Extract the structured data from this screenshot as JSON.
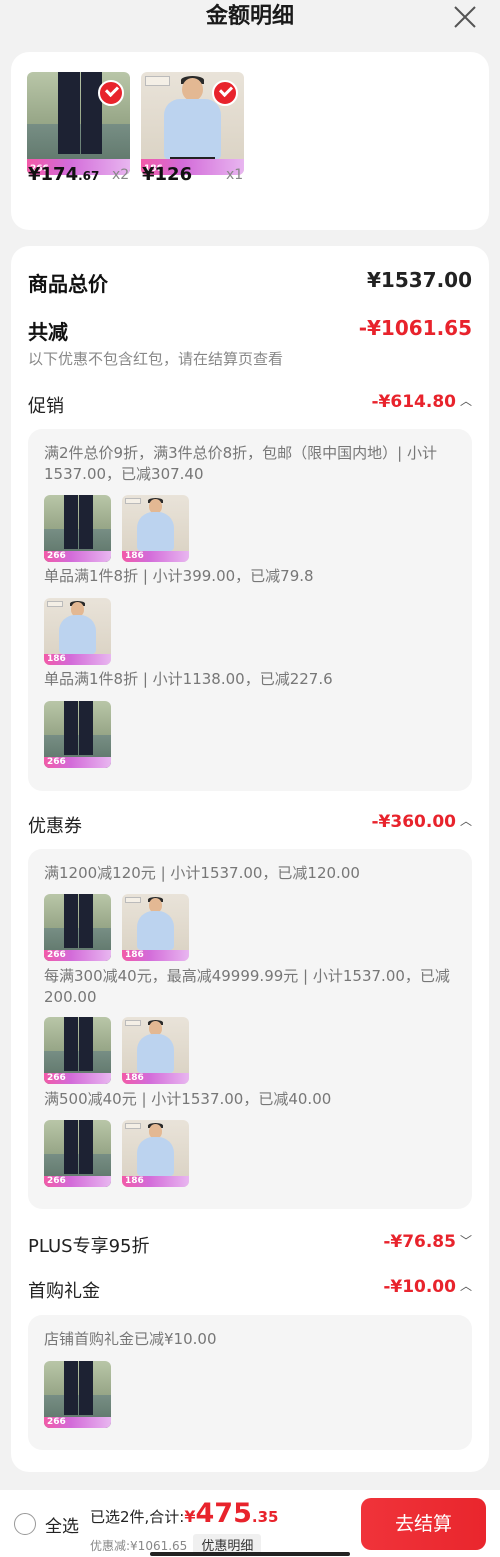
{
  "header": {
    "title": "金额明细"
  },
  "top_items": [
    {
      "type": "pants",
      "badge": "266",
      "price_int": "¥174",
      "price_dec": ".67",
      "qty": "x2"
    },
    {
      "type": "shirt",
      "badge": "186",
      "price_int": "¥126",
      "price_dec": "",
      "qty": "x1"
    }
  ],
  "summary": {
    "total_label": "商品总价",
    "total_value": "¥1537.00",
    "discount_label": "共减",
    "discount_value": "-¥1061.65",
    "discount_note": "以下优惠不包含红包，请在结算页查看"
  },
  "promo": {
    "label": "促销",
    "value": "-¥614.80",
    "lines": [
      "满2件总价9折，满3件总价8折，包邮（限中国内地）| 小计1537.00，已减307.40",
      "单品满1件8折 | 小计399.00，已减79.8",
      "单品满1件8折 | 小计1138.00，已减227.6"
    ]
  },
  "coupon": {
    "label": "优惠券",
    "value": "-¥360.00",
    "lines": [
      "满1200减120元 | 小计1537.00，已减120.00",
      "每满300减40元，最高减49999.99元 | 小计1537.00，已减200.00",
      "满500减40元 | 小计1537.00，已减40.00"
    ]
  },
  "plus": {
    "label": "PLUS专享95折",
    "value": "-¥76.85"
  },
  "first_gift": {
    "label": "首购礼金",
    "value": "-¥10.00",
    "lines": [
      "店铺首购礼金已减¥10.00"
    ]
  },
  "bottom": {
    "select_all": "全选",
    "selected_text": "已选2件,合计:",
    "total_yen": "¥",
    "total_int": "475",
    "total_dec": ".35",
    "discount_text": "优惠减:¥1061.65",
    "detail_btn": "优惠明细",
    "checkout": "去结算"
  },
  "colors": {
    "accent": "#e8232c",
    "background": "#f2f2f2"
  }
}
